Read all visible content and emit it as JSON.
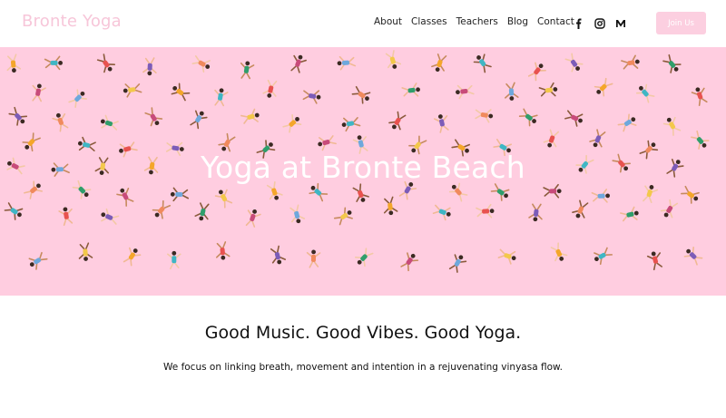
{
  "site": {
    "brand": "Bronte Yoga"
  },
  "nav": {
    "items": [
      "About",
      "Classes",
      "Teachers",
      "Blog",
      "Contact"
    ]
  },
  "social": [
    "facebook-icon",
    "instagram-icon",
    "medium-icon"
  ],
  "cta": {
    "label": "Join Us"
  },
  "hero": {
    "title": "Yoga at Bronte Beach",
    "background": "#ffcde0"
  },
  "content": {
    "headline": "Good Music. Good Vibes. Good Yoga.",
    "description": "We focus on linking breath, movement and intention in a rejuvenating vinyasa flow."
  },
  "colors": {
    "brand": "#f7c6d9",
    "button": "#fccfe0",
    "hero": "#ffcde0"
  }
}
